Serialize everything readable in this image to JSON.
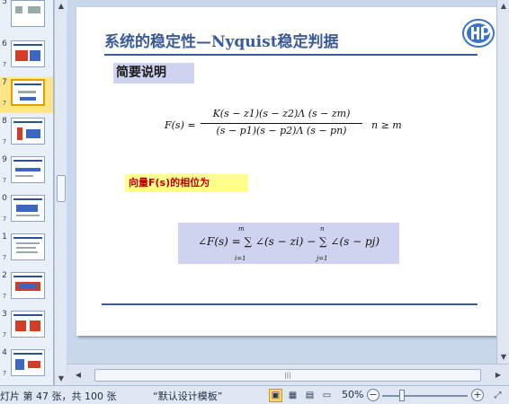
{
  "thumbnails": [
    {
      "num": "5",
      "star": ""
    },
    {
      "num": "6",
      "star": "7"
    },
    {
      "num": "7",
      "star": "7"
    },
    {
      "num": "8",
      "star": "7"
    },
    {
      "num": "9",
      "star": "7"
    },
    {
      "num": "0",
      "star": "7"
    },
    {
      "num": "1",
      "star": "7"
    },
    {
      "num": "2",
      "star": "7"
    },
    {
      "num": "3",
      "star": "7"
    },
    {
      "num": "4",
      "star": "7"
    }
  ],
  "slide": {
    "title": "系统的稳定性—Nyquist稳定判据",
    "section_label": "简要说明",
    "formula1": {
      "lhs": "F(s) =",
      "numerator": "K(s − z1)(s − z2)Λ (s − zm)",
      "denominator": "(s − p1)(s − p2)Λ (s − pn)",
      "condition": "n ≥ m"
    },
    "phase_label": "向量F(s)的相位为",
    "formula2": {
      "expression": "∠F(s) = ∑ ∠(s − zi) − ∑ ∠(s − pj)",
      "sum1_upper": "m",
      "sum1_lower": "i=1",
      "sum2_upper": "n",
      "sum2_lower": "j=1"
    }
  },
  "scrollbar_grip": "|||",
  "status": {
    "slide_info": "灯片 第 47 张，共 100 张",
    "template": "“默认设计模板”",
    "zoom": "50%",
    "zoom_minus": "−",
    "zoom_plus": "+"
  },
  "colors": {
    "title": "#3a5a98",
    "highlight_yellow": "#ffff8c",
    "highlight_lavender": "#cfd3ef",
    "phase_text": "#c00000"
  }
}
